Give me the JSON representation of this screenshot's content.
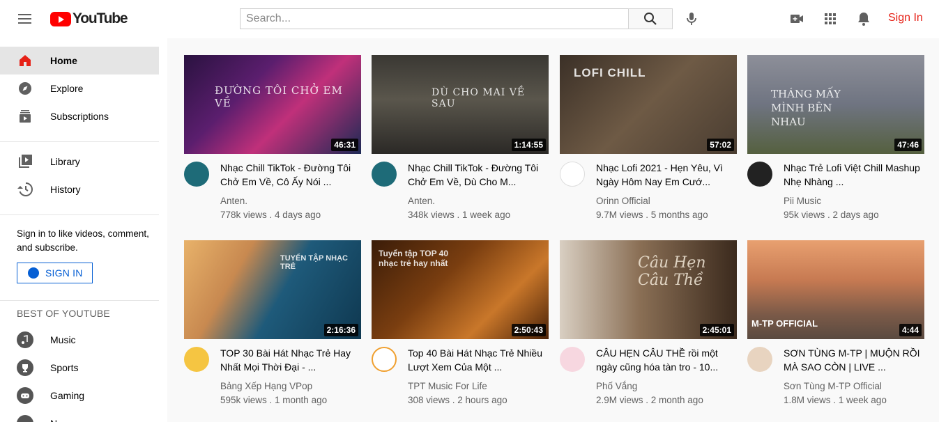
{
  "header": {
    "logo_text": "YouTube",
    "search_placeholder": "Search...",
    "sign_in_label": "Sign In"
  },
  "sidebar": {
    "main_items": [
      {
        "label": "Home",
        "icon": "home-icon",
        "active": true
      },
      {
        "label": "Explore",
        "icon": "compass-icon"
      },
      {
        "label": "Subscriptions",
        "icon": "subscriptions-icon"
      }
    ],
    "library_items": [
      {
        "label": "Library",
        "icon": "library-icon"
      },
      {
        "label": "History",
        "icon": "history-icon"
      }
    ],
    "sign_in_prompt": "Sign in to like videos, comment, and subscribe.",
    "sign_in_button": "SIGN IN",
    "best_of_title": "BEST OF YOUTUBE",
    "best_of_items": [
      {
        "label": "Music",
        "icon": "music-icon"
      },
      {
        "label": "Sports",
        "icon": "trophy-icon"
      },
      {
        "label": "Gaming",
        "icon": "gaming-icon"
      },
      {
        "label": "N",
        "icon": "news-icon"
      }
    ]
  },
  "videos": [
    {
      "title": "Nhạc Chill TikTok - Đường Tôi Chở Em Về, Cô Ấy Nói ...",
      "channel": "Anten.",
      "meta": "778k views . 4 days ago",
      "duration": "46:31",
      "thumb_text": "ĐƯỜNG TÔI CHỞ EM VỀ"
    },
    {
      "title": "Nhạc Chill TikTok - Đường Tôi Chở Em Về, Dù Cho M...",
      "channel": "Anten.",
      "meta": "348k views . 1 week ago",
      "duration": "1:14:55",
      "thumb_text": "DÙ CHO MAI VỀ SAU"
    },
    {
      "title": "Nhạc Lofi 2021 - Hẹn Yêu, Vì Ngày Hôm Nay Em Cướ...",
      "channel": "Orinn Official",
      "meta": "9.7M views . 5 months ago",
      "duration": "57:02",
      "thumb_text": "LOFI CHILL"
    },
    {
      "title": "Nhạc Trẻ Lofi Việt Chill Mashup Nhẹ Nhàng ...",
      "channel": "Pii Music",
      "meta": "95k views . 2 days ago",
      "duration": "47:46",
      "thumb_text": "THÁNG MẤY MÌNH BÊN NHAU"
    },
    {
      "title": "TOP 30 Bài Hát Nhạc Trẻ Hay Nhất Mọi Thời Đại - ...",
      "channel": "Bảng Xếp Hạng VPop",
      "meta": "595k views . 1 month ago",
      "duration": "2:16:36",
      "thumb_text": "TUYỂN TẬP NHẠC TRẺ"
    },
    {
      "title": "Top 40 Bài Hát Nhạc Trẻ Nhiều Lượt Xem Của Một ...",
      "channel": "TPT Music For Life",
      "meta": "308 views . 2 hours ago",
      "duration": "2:50:43",
      "thumb_text": "Tuyển tập TOP 40 nhạc trẻ hay nhất"
    },
    {
      "title": "CÂU HẸN CÂU THỀ rồi một ngày cũng hóa tàn tro - 10...",
      "channel": "Phố Vắng",
      "meta": "2.9M views . 2 month ago",
      "duration": "2:45:01",
      "thumb_text": "Câu Hẹn Câu Thề"
    },
    {
      "title": "SƠN TÙNG M-TP | MUỘN RỒI MÀ SAO CÒN | LIVE ...",
      "channel": "Sơn Tùng M-TP Official",
      "meta": "1.8M views . 1 week ago",
      "duration": "4:44",
      "thumb_text": "M-TP OFFICIAL"
    }
  ],
  "colors": {
    "brand_red": "#ff0000",
    "sign_in_red": "#e62117",
    "link_blue": "#065fd4"
  }
}
